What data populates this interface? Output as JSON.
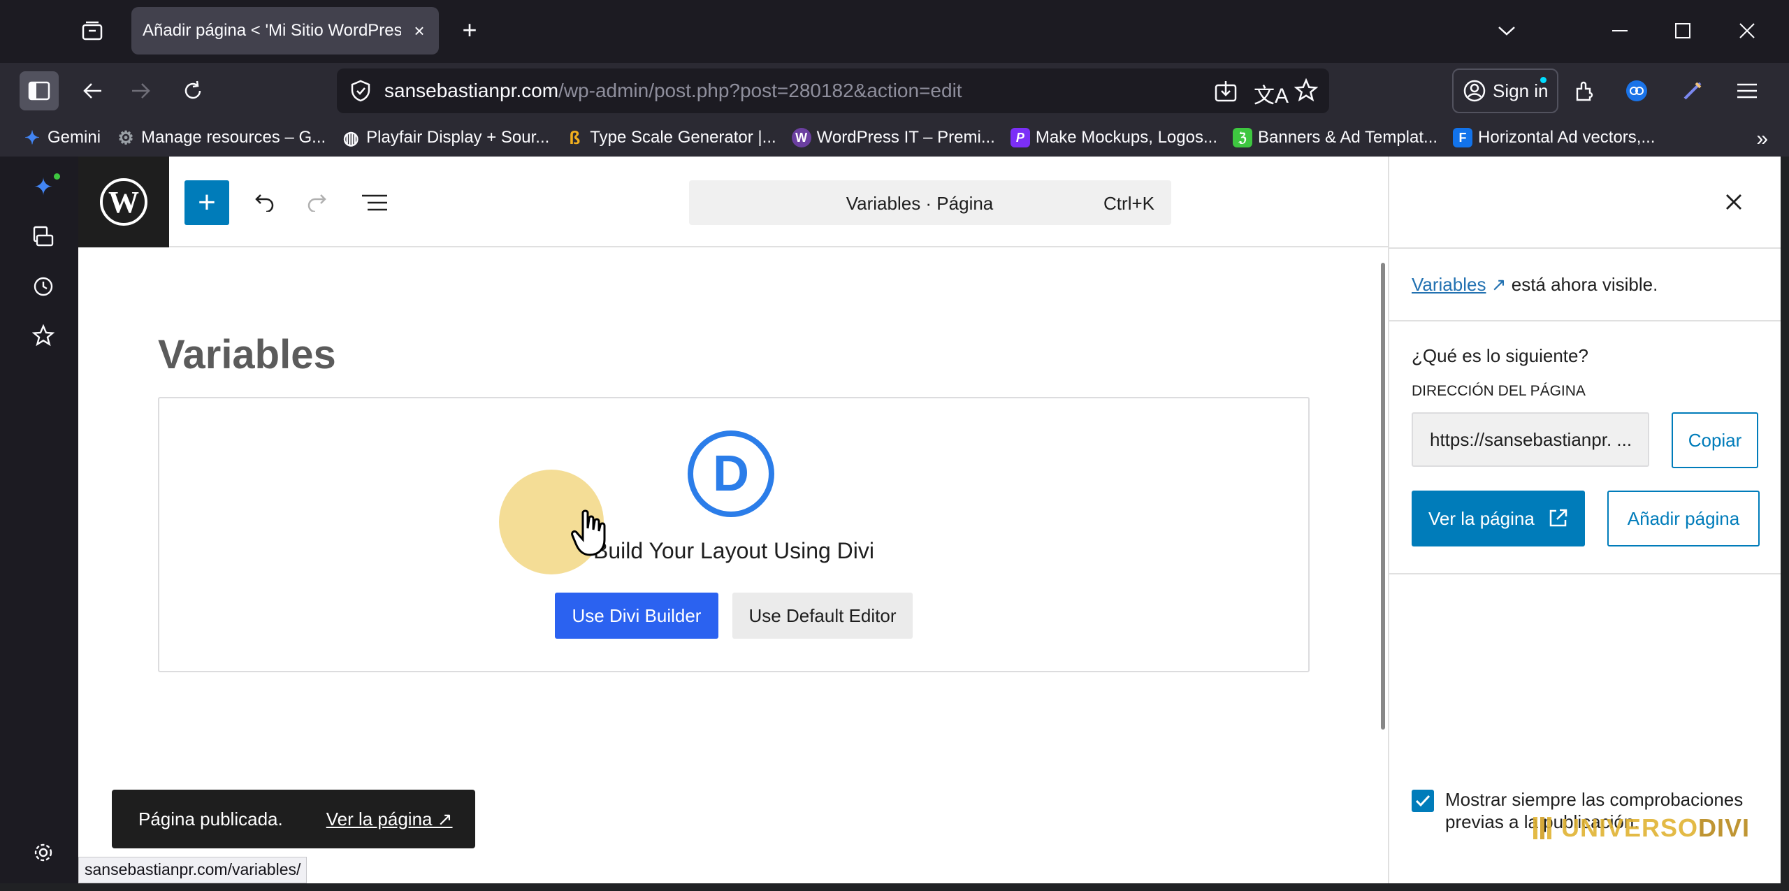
{
  "browser": {
    "tab_title": "Añadir página < 'Mi Sitio WordPress",
    "url_host": "sansebastianpr.com",
    "url_path": "/wp-admin/post.php?post=280182&action=edit",
    "sign_in_label": "Sign in",
    "status_url": "sansebastianpr.com/variables/",
    "bookmarks": [
      {
        "label": "Gemini",
        "icon": "gemini-icon",
        "color": "#4285f4"
      },
      {
        "label": "Manage resources – G...",
        "icon": "gear-icon",
        "color": "#5f6368"
      },
      {
        "label": "Playfair Display + Sour...",
        "icon": "globe-icon",
        "color": "#3c3c3c"
      },
      {
        "label": "Type Scale Generator |...",
        "icon": "typescale-icon",
        "color": "#f2b01e"
      },
      {
        "label": "WordPress IT – Premi...",
        "icon": "wp-it-icon",
        "color": "#6b3fa0"
      },
      {
        "label": "Make Mockups, Logos...",
        "icon": "placeit-icon",
        "color": "#7b2ff7"
      },
      {
        "label": "Banners & Ad Templat...",
        "icon": "banner-icon",
        "color": "#3ec740"
      },
      {
        "label": "Horizontal Ad vectors,...",
        "icon": "freepik-icon",
        "color": "#1273eb"
      }
    ]
  },
  "wp": {
    "command_title": "Variables · Página",
    "command_shortcut": "Ctrl+K",
    "post_title": "Variables",
    "divi": {
      "logo_letter": "D",
      "heading": "Build Your Layout Using Divi",
      "use_divi_label": "Use Divi Builder",
      "use_default_label": "Use Default Editor"
    },
    "snackbar": {
      "text": "Página publicada.",
      "link": "Ver la página ↗"
    },
    "panel": {
      "visible_link": "Variables",
      "visible_arrow": "↗",
      "visible_rest": "está ahora visible.",
      "next_title": "¿Qué es lo siguiente?",
      "address_label": "DIRECCIÓN DEL PÁGINA",
      "address_value": "https://sansebastianpr. ...",
      "copy_label": "Copiar",
      "view_label": "Ver la página",
      "add_label": "Añadir página",
      "checkbox_label": "Mostrar siempre las comprobaciones previas a la publicación.",
      "checkbox_checked": true
    },
    "watermark": {
      "part1": "UNIVERSO",
      "part2": "DIVI"
    }
  },
  "colors": {
    "wp_blue": "#007cba",
    "divi_blue": "#2b62f0",
    "divi_logo": "#2b7de9"
  }
}
